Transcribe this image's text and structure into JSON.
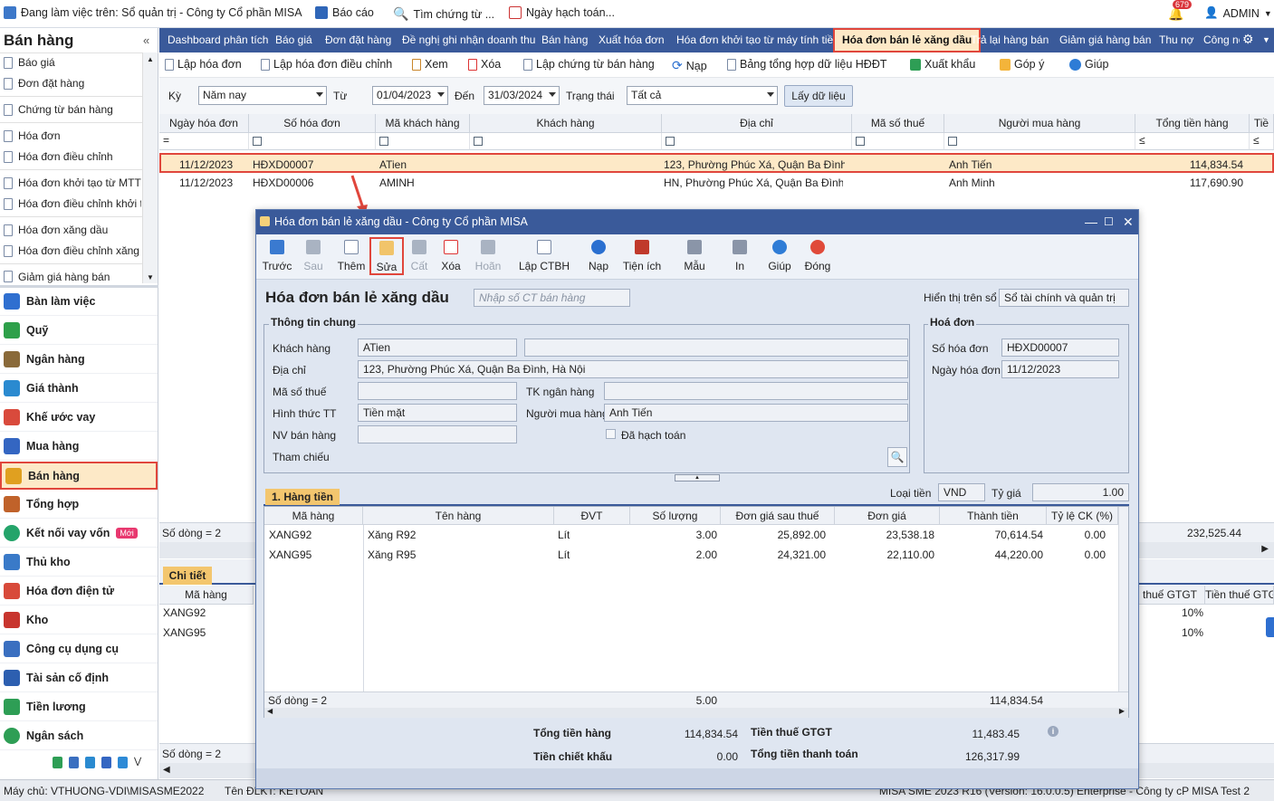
{
  "topbar": {
    "workspace": "Đang làm việc trên: Sổ quản trị - Công ty Cổ phần MISA",
    "report": "Báo cáo",
    "search": "Tìm chứng từ ...",
    "posting_date": "Ngày hạch toán...",
    "notif_count": "679",
    "user": "ADMIN"
  },
  "sidebar": {
    "title": "Bán hàng",
    "sub_items": [
      "Báo giá",
      "Đơn đặt hàng",
      "Chứng từ bán hàng",
      "Hóa đơn",
      "Hóa đơn điều chỉnh",
      "Hóa đơn khởi tạo từ MTT",
      "Hóa đơn điều chỉnh khởi tạo...",
      "Hóa đơn xăng dầu",
      "Hóa đơn điều chỉnh xăng dầu",
      "Giảm giá hàng bán"
    ],
    "modules": [
      "Bàn làm việc",
      "Quỹ",
      "Ngân hàng",
      "Giá thành",
      "Khế ước vay",
      "Mua hàng",
      "Bán hàng",
      "Tổng hợp",
      "Kết nối vay vốn",
      "Thủ kho",
      "Hóa đơn điện tử",
      "Kho",
      "Công cụ dụng cụ",
      "Tài sản cố định",
      "Tiền lương",
      "Ngân sách"
    ],
    "new_badge": "Mới"
  },
  "tabs": [
    "Dashboard phân tích",
    "Báo giá",
    "Đơn đặt hàng",
    "Đề nghị ghi nhận doanh thu",
    "Bán hàng",
    "Xuất hóa đơn",
    "Hóa đơn khởi tạo từ máy tính tiền",
    "Hóa đơn bán lẻ xăng dầu",
    "Trả lại hàng bán",
    "Giảm giá hàng bán",
    "Thu nợ",
    "Công nợ"
  ],
  "toolbar": [
    "Lập hóa đơn",
    "Lập hóa đơn điều chỉnh",
    "Xem",
    "Xóa",
    "Lập chứng từ bán hàng",
    "Nạp",
    "Bảng tổng hợp dữ liệu HĐĐT",
    "Xuất khẩu",
    "Góp ý",
    "Giúp"
  ],
  "filter": {
    "period_label": "Kỳ",
    "period": "Năm nay",
    "from_label": "Từ",
    "from": "01/04/2023",
    "to_label": "Đến",
    "to": "31/03/2024",
    "status_label": "Trạng thái",
    "status": "Tất cả",
    "fetch": "Lấy dữ liệu"
  },
  "grid": {
    "headers": [
      "Ngày hóa đơn",
      "Số hóa đơn",
      "Mã khách hàng",
      "Khách hàng",
      "Địa chỉ",
      "Mã số thuế",
      "Người mua hàng",
      "Tổng tiền hàng",
      "Tiề"
    ],
    "rows": [
      {
        "date": "11/12/2023",
        "no": "HĐXD00007",
        "code": "ATien",
        "addr": "123, Phường Phúc Xá, Quận Ba Đình,...",
        "buyer": "Anh Tiến",
        "total": "114,834.54"
      },
      {
        "date": "11/12/2023",
        "no": "HĐXD00006",
        "code": "AMINH",
        "addr": "HN, Phường Phúc Xá, Quận Ba Đình,...",
        "buyer": "Anh Minh",
        "total": "117,690.90"
      }
    ],
    "row_count": "Số dòng = 2",
    "sum_total": "232,525.44"
  },
  "detail": {
    "tab": "Chi tiết",
    "col_code": "Mã hàng",
    "codes": [
      "XANG92",
      "XANG95"
    ],
    "col_vat": "thuế GTGT",
    "col_vat_amt": "Tiền thuế GTGT",
    "vats": [
      "10%",
      "10%"
    ],
    "row_count": "Số dòng = 2"
  },
  "modal": {
    "title": "Hóa đơn bán lẻ xăng dầu - Công ty Cổ phần MISA",
    "tools": [
      "Trước",
      "Sau",
      "Thêm",
      "Sửa",
      "Cất",
      "Xóa",
      "Hoãn",
      "Lập CTBH",
      "Nạp",
      "Tiện ích",
      "Mẫu",
      "In",
      "Giúp",
      "Đóng"
    ],
    "heading": "Hóa đơn bán lẻ xăng dầu",
    "ct_placeholder": "Nhập số CT bán hàng",
    "show_on_label": "Hiển thị trên sổ",
    "show_on": "Sổ tài chính và quản trị",
    "general": {
      "title": "Thông tin chung",
      "customer_label": "Khách hàng",
      "customer": "ATien",
      "address_label": "Địa chỉ",
      "address": "123, Phường Phúc Xá, Quận Ba Đình, Hà Nội",
      "tax_label": "Mã số thuế",
      "bank_label": "TK ngân hàng",
      "payment_label": "Hình thức TT",
      "payment": "Tiền mặt",
      "buyer_label": "Người mua hàng",
      "buyer": "Anh Tiến",
      "seller_label": "NV bán hàng",
      "posted_label": "Đã hạch toán",
      "ref_label": "Tham chiếu"
    },
    "invoice": {
      "title": "Hoá đơn",
      "no_label": "Số hóa đơn",
      "no": "HĐXD00007",
      "date_label": "Ngày hóa đơn",
      "date": "11/12/2023"
    },
    "currency_label": "Loại tiền",
    "currency": "VND",
    "rate_label": "Tỷ giá",
    "rate": "1.00",
    "tab": "1. Hàng tiền",
    "headers": [
      "Mã hàng",
      "Tên hàng",
      "ĐVT",
      "Số lượng",
      "Đơn giá sau thuế",
      "Đơn giá",
      "Thành tiền",
      "Tỷ lệ CK (%)"
    ],
    "lines": [
      {
        "code": "XANG92",
        "name": "Xăng R92",
        "unit": "Lít",
        "qty": "3.00",
        "price_tax": "25,892.00",
        "price": "23,538.18",
        "amount": "70,614.54",
        "disc": "0.00"
      },
      {
        "code": "XANG95",
        "name": "Xăng R95",
        "unit": "Lít",
        "qty": "2.00",
        "price_tax": "24,321.00",
        "price": "22,110.00",
        "amount": "44,220.00",
        "disc": "0.00"
      }
    ],
    "row_count": "Số dòng = 2",
    "sum_qty": "5.00",
    "sum_amount": "114,834.54",
    "totals": {
      "goods_label": "Tổng tiền hàng",
      "goods": "114,834.54",
      "disc_label": "Tiền chiết khấu",
      "disc": "0.00",
      "vat_label": "Tiền thuế GTGT",
      "vat": "11,483.45",
      "pay_label": "Tổng tiền thanh toán",
      "pay": "126,317.99"
    }
  },
  "status": {
    "server": "Máy chủ: VTHUONG-VDI\\MISASME2022",
    "login": "Tên ĐLKT: KETOAN",
    "version": "MISA SME 2023 R16 (Version: 16.0.0.5) Enterprise - Công ty cP MISA Test 2"
  }
}
